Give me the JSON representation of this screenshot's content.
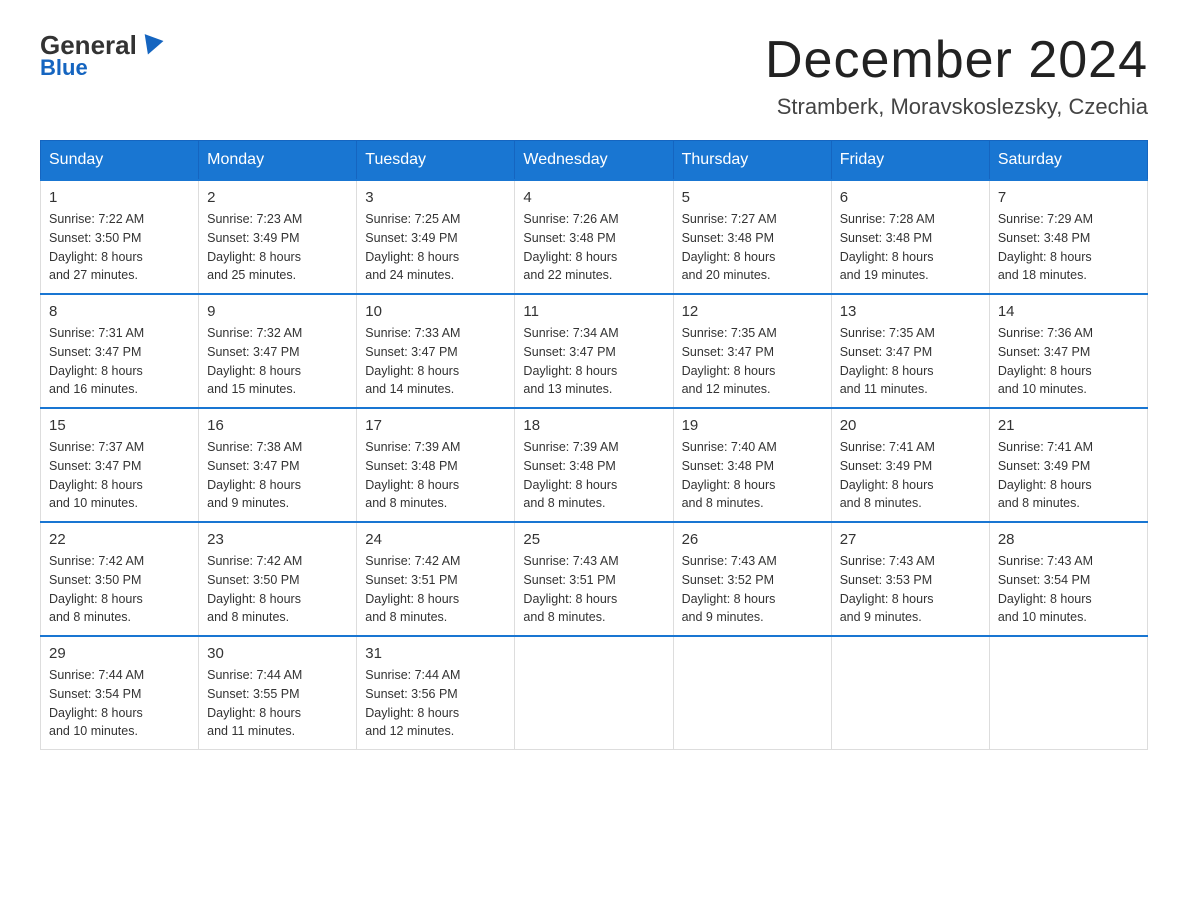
{
  "logo": {
    "general": "General",
    "blue": "Blue",
    "underline": "Blue"
  },
  "header": {
    "month_title": "December 2024",
    "location": "Stramberk, Moravskoslezsky, Czechia"
  },
  "weekdays": [
    "Sunday",
    "Monday",
    "Tuesday",
    "Wednesday",
    "Thursday",
    "Friday",
    "Saturday"
  ],
  "weeks": [
    [
      {
        "day": "1",
        "sunrise": "7:22 AM",
        "sunset": "3:50 PM",
        "daylight": "8 hours and 27 minutes."
      },
      {
        "day": "2",
        "sunrise": "7:23 AM",
        "sunset": "3:49 PM",
        "daylight": "8 hours and 25 minutes."
      },
      {
        "day": "3",
        "sunrise": "7:25 AM",
        "sunset": "3:49 PM",
        "daylight": "8 hours and 24 minutes."
      },
      {
        "day": "4",
        "sunrise": "7:26 AM",
        "sunset": "3:48 PM",
        "daylight": "8 hours and 22 minutes."
      },
      {
        "day": "5",
        "sunrise": "7:27 AM",
        "sunset": "3:48 PM",
        "daylight": "8 hours and 20 minutes."
      },
      {
        "day": "6",
        "sunrise": "7:28 AM",
        "sunset": "3:48 PM",
        "daylight": "8 hours and 19 minutes."
      },
      {
        "day": "7",
        "sunrise": "7:29 AM",
        "sunset": "3:48 PM",
        "daylight": "8 hours and 18 minutes."
      }
    ],
    [
      {
        "day": "8",
        "sunrise": "7:31 AM",
        "sunset": "3:47 PM",
        "daylight": "8 hours and 16 minutes."
      },
      {
        "day": "9",
        "sunrise": "7:32 AM",
        "sunset": "3:47 PM",
        "daylight": "8 hours and 15 minutes."
      },
      {
        "day": "10",
        "sunrise": "7:33 AM",
        "sunset": "3:47 PM",
        "daylight": "8 hours and 14 minutes."
      },
      {
        "day": "11",
        "sunrise": "7:34 AM",
        "sunset": "3:47 PM",
        "daylight": "8 hours and 13 minutes."
      },
      {
        "day": "12",
        "sunrise": "7:35 AM",
        "sunset": "3:47 PM",
        "daylight": "8 hours and 12 minutes."
      },
      {
        "day": "13",
        "sunrise": "7:35 AM",
        "sunset": "3:47 PM",
        "daylight": "8 hours and 11 minutes."
      },
      {
        "day": "14",
        "sunrise": "7:36 AM",
        "sunset": "3:47 PM",
        "daylight": "8 hours and 10 minutes."
      }
    ],
    [
      {
        "day": "15",
        "sunrise": "7:37 AM",
        "sunset": "3:47 PM",
        "daylight": "8 hours and 10 minutes."
      },
      {
        "day": "16",
        "sunrise": "7:38 AM",
        "sunset": "3:47 PM",
        "daylight": "8 hours and 9 minutes."
      },
      {
        "day": "17",
        "sunrise": "7:39 AM",
        "sunset": "3:48 PM",
        "daylight": "8 hours and 8 minutes."
      },
      {
        "day": "18",
        "sunrise": "7:39 AM",
        "sunset": "3:48 PM",
        "daylight": "8 hours and 8 minutes."
      },
      {
        "day": "19",
        "sunrise": "7:40 AM",
        "sunset": "3:48 PM",
        "daylight": "8 hours and 8 minutes."
      },
      {
        "day": "20",
        "sunrise": "7:41 AM",
        "sunset": "3:49 PM",
        "daylight": "8 hours and 8 minutes."
      },
      {
        "day": "21",
        "sunrise": "7:41 AM",
        "sunset": "3:49 PM",
        "daylight": "8 hours and 8 minutes."
      }
    ],
    [
      {
        "day": "22",
        "sunrise": "7:42 AM",
        "sunset": "3:50 PM",
        "daylight": "8 hours and 8 minutes."
      },
      {
        "day": "23",
        "sunrise": "7:42 AM",
        "sunset": "3:50 PM",
        "daylight": "8 hours and 8 minutes."
      },
      {
        "day": "24",
        "sunrise": "7:42 AM",
        "sunset": "3:51 PM",
        "daylight": "8 hours and 8 minutes."
      },
      {
        "day": "25",
        "sunrise": "7:43 AM",
        "sunset": "3:51 PM",
        "daylight": "8 hours and 8 minutes."
      },
      {
        "day": "26",
        "sunrise": "7:43 AM",
        "sunset": "3:52 PM",
        "daylight": "8 hours and 9 minutes."
      },
      {
        "day": "27",
        "sunrise": "7:43 AM",
        "sunset": "3:53 PM",
        "daylight": "8 hours and 9 minutes."
      },
      {
        "day": "28",
        "sunrise": "7:43 AM",
        "sunset": "3:54 PM",
        "daylight": "8 hours and 10 minutes."
      }
    ],
    [
      {
        "day": "29",
        "sunrise": "7:44 AM",
        "sunset": "3:54 PM",
        "daylight": "8 hours and 10 minutes."
      },
      {
        "day": "30",
        "sunrise": "7:44 AM",
        "sunset": "3:55 PM",
        "daylight": "8 hours and 11 minutes."
      },
      {
        "day": "31",
        "sunrise": "7:44 AM",
        "sunset": "3:56 PM",
        "daylight": "8 hours and 12 minutes."
      },
      null,
      null,
      null,
      null
    ]
  ],
  "labels": {
    "sunrise": "Sunrise:",
    "sunset": "Sunset:",
    "daylight": "Daylight:"
  }
}
